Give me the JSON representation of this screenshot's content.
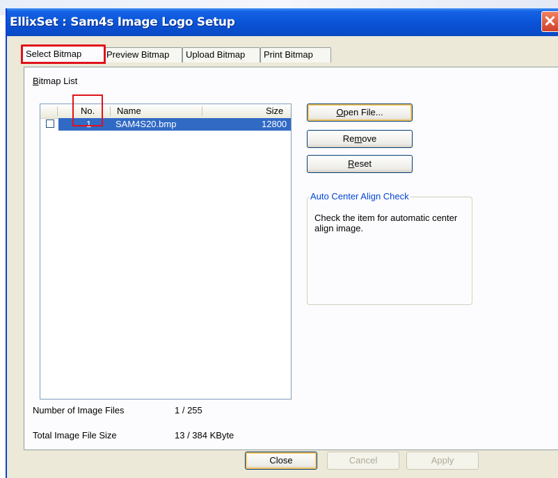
{
  "window": {
    "title": "EllixSet : Sam4s Image Logo Setup",
    "close_glyph": "✕"
  },
  "tabs": [
    {
      "label": "Select Bitmap",
      "active": true
    },
    {
      "label": "Preview Bitmap",
      "active": false
    },
    {
      "label": "Upload Bitmap",
      "active": false
    },
    {
      "label": "Print Bitmap",
      "active": false
    }
  ],
  "bitmap_list": {
    "label_prefix": "B",
    "label_rest": "itmap List",
    "columns": {
      "no": "No.",
      "name": "Name",
      "size": "Size"
    },
    "rows": [
      {
        "checked": false,
        "no": "1",
        "name": "SAM4S20.bmp",
        "size": "12800",
        "selected": true
      }
    ]
  },
  "buttons": {
    "open_file": {
      "u": "O",
      "rest": "pen File..."
    },
    "remove": {
      "pre": "Re",
      "u": "m",
      "rest": "ove"
    },
    "reset": {
      "u": "R",
      "rest": "eset"
    },
    "close": "Close",
    "cancel": "Cancel",
    "apply": "Apply"
  },
  "auto_center": {
    "title": "Auto Center Align Check",
    "text": "Check the item for automatic center align image."
  },
  "stats": {
    "image_files_label": "Number of Image Files",
    "image_files_value": "1 / 255",
    "total_size_label": "Total Image File Size",
    "total_size_value": "13 / 384 KByte"
  },
  "colors": {
    "title_bar": "#0a52d6",
    "selection": "#316ac5",
    "highlight": "#e0101a",
    "group_title": "#0046d5"
  },
  "icons": {
    "close": "close-icon",
    "checkbox": "checkbox-icon"
  }
}
